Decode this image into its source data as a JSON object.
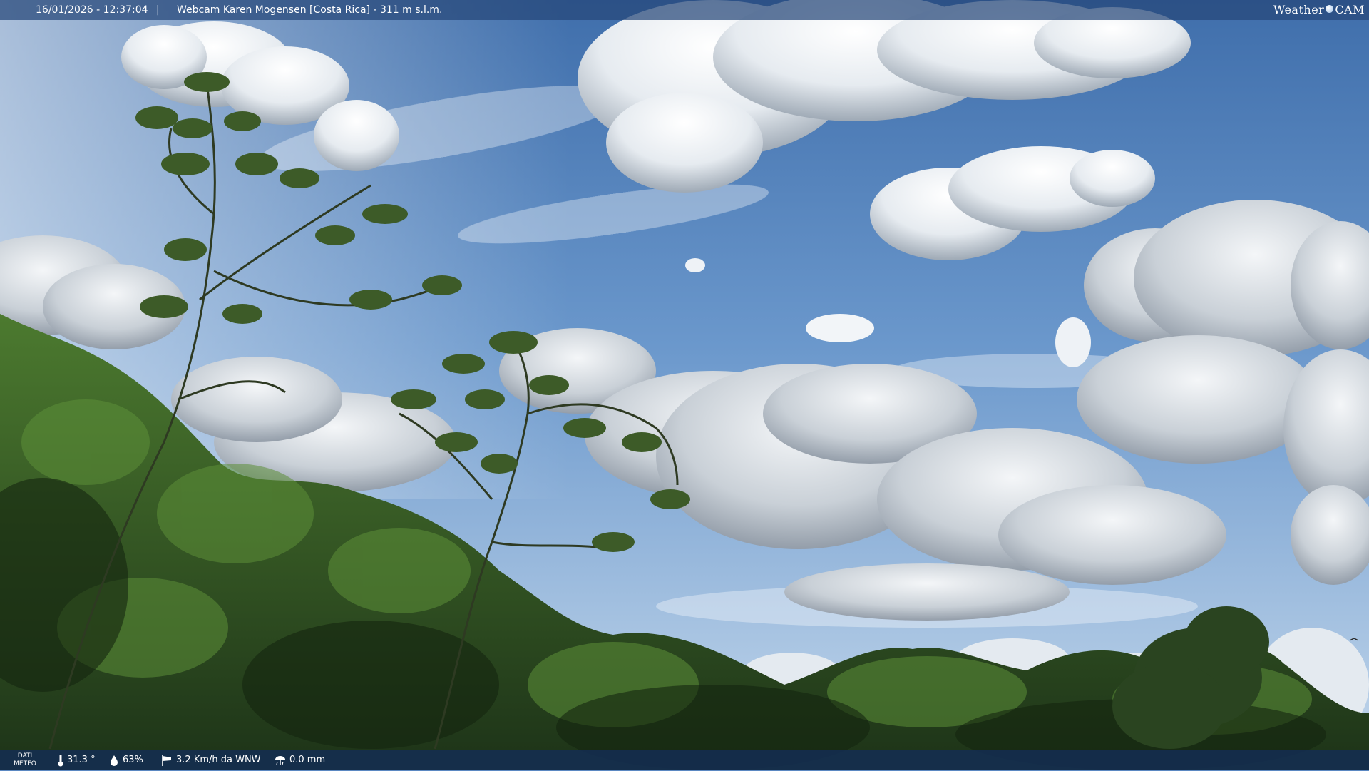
{
  "overlay": {
    "timestamp": "16/01/2026 - 12:37:04",
    "separator": "|",
    "title": "Webcam Karen Mogensen [Costa Rica] - 311 m s.l.m.",
    "logo_left": "Weather",
    "logo_right": "CAM"
  },
  "weather": {
    "label": "DATI METEO",
    "temperature": "31.3 °",
    "humidity": "63%",
    "wind": "3.2 Km/h da WNW",
    "rain": "0.0 mm"
  },
  "icons": {
    "temperature": "thermometer-icon",
    "humidity": "droplet-icon",
    "wind": "windsock-icon",
    "rain": "rain-gauge-icon"
  },
  "colors": {
    "sky_top": "#3f6eab",
    "sky_bottom": "#c4d8ec",
    "foliage": "#2d4a22",
    "overlay_bar": "#26467a"
  }
}
